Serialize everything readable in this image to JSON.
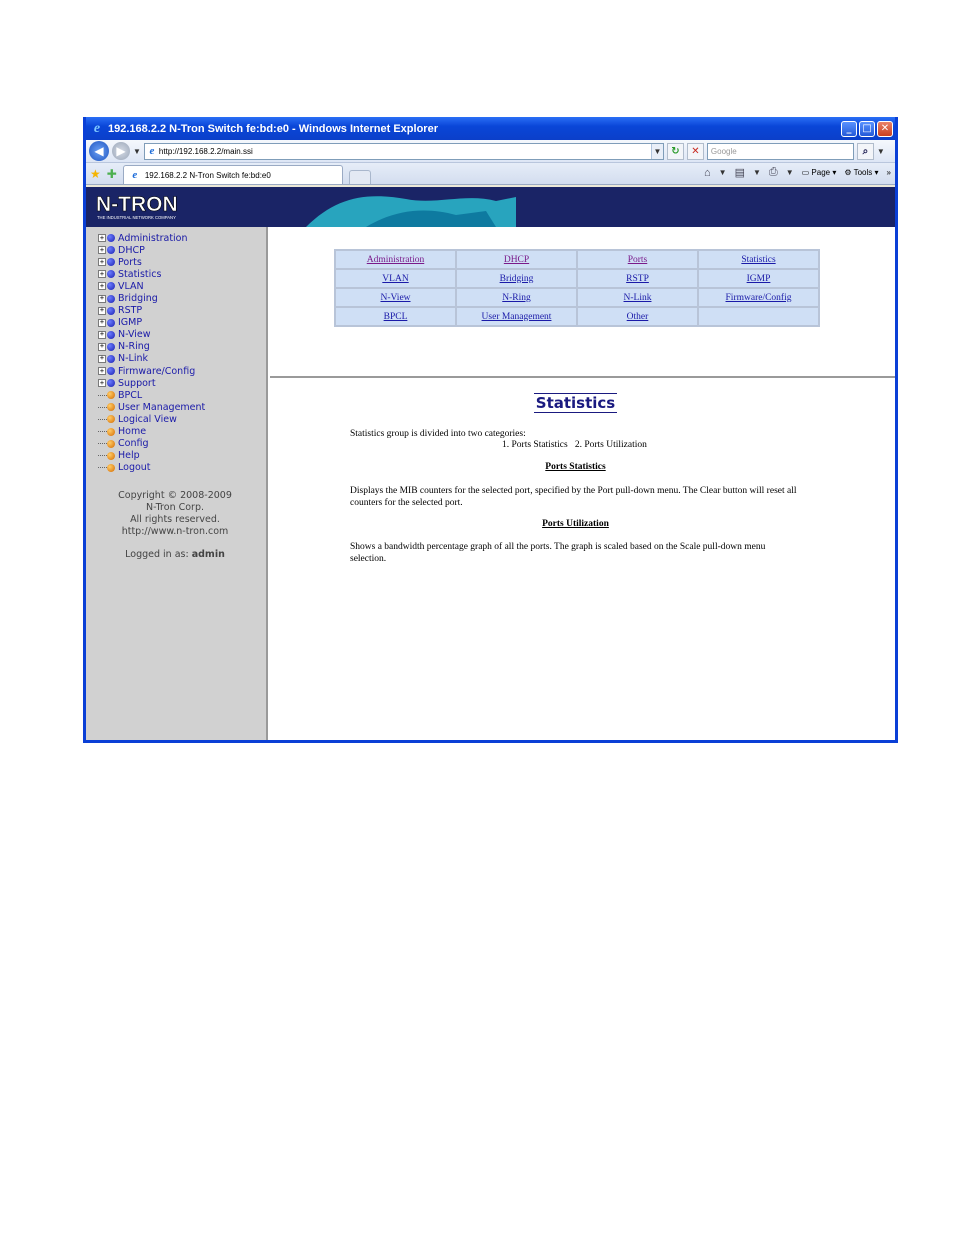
{
  "window": {
    "title": "192.168.2.2 N-Tron Switch fe:bd:e0 - Windows Internet Explorer",
    "buttons": [
      "minimize",
      "maximize",
      "close"
    ]
  },
  "address_bar": {
    "url": "http://192.168.2.2/main.ssi",
    "search_placeholder": "Google"
  },
  "tabs": [
    {
      "title": "192.168.2.2 N-Tron Switch fe:bd:e0"
    }
  ],
  "command_bar": {
    "page_label": "Page",
    "tools_label": "Tools"
  },
  "banner": {
    "logo_text": "N-TRON",
    "tagline": "THE INDUSTRIAL NETWORK COMPANY"
  },
  "sidebar": {
    "items": [
      {
        "label": "Administration",
        "expandable": true,
        "bullet": "blue"
      },
      {
        "label": "DHCP",
        "expandable": true,
        "bullet": "blue"
      },
      {
        "label": "Ports",
        "expandable": true,
        "bullet": "blue"
      },
      {
        "label": "Statistics",
        "expandable": true,
        "bullet": "blue"
      },
      {
        "label": "VLAN",
        "expandable": true,
        "bullet": "blue"
      },
      {
        "label": "Bridging",
        "expandable": true,
        "bullet": "blue"
      },
      {
        "label": "RSTP",
        "expandable": true,
        "bullet": "blue"
      },
      {
        "label": "IGMP",
        "expandable": true,
        "bullet": "blue"
      },
      {
        "label": "N-View",
        "expandable": true,
        "bullet": "blue"
      },
      {
        "label": "N-Ring",
        "expandable": true,
        "bullet": "blue"
      },
      {
        "label": "N-Link",
        "expandable": true,
        "bullet": "blue"
      },
      {
        "label": "Firmware/Config",
        "expandable": true,
        "bullet": "blue"
      },
      {
        "label": "Support",
        "expandable": true,
        "bullet": "blue"
      },
      {
        "label": "BPCL",
        "expandable": false,
        "bullet": "orange"
      },
      {
        "label": "User Management",
        "expandable": false,
        "bullet": "orange"
      },
      {
        "label": "Logical View",
        "expandable": false,
        "bullet": "orange"
      },
      {
        "label": "Home",
        "expandable": false,
        "bullet": "orange"
      },
      {
        "label": "Config",
        "expandable": false,
        "bullet": "orange"
      },
      {
        "label": "Help",
        "expandable": false,
        "bullet": "orange"
      },
      {
        "label": "Logout",
        "expandable": false,
        "bullet": "orange"
      }
    ],
    "copyright": [
      "Copyright © 2008-2009",
      "N-Tron Corp.",
      "All rights reserved.",
      "http://www.n-tron.com"
    ],
    "logged_in_label": "Logged in as:",
    "logged_in_user": "admin"
  },
  "nav_table": {
    "rows": [
      [
        "Administration",
        "DHCP",
        "Ports",
        "Statistics"
      ],
      [
        "VLAN",
        "Bridging",
        "RSTP",
        "IGMP"
      ],
      [
        "N-View",
        "N-Ring",
        "N-Link",
        "Firmware/Config"
      ],
      [
        "BPCL",
        "User Management",
        "Other",
        ""
      ]
    ]
  },
  "main": {
    "title": "Statistics",
    "intro": "Statistics group is divided into two categories:",
    "categories": "1. Ports Statistics   2. Ports Utilization",
    "section1_heading": "Ports Statistics",
    "section1_text": "Displays the MIB counters for the selected port, specified by the Port pull-down menu. The Clear button will reset all counters for the selected port.",
    "section2_heading": "Ports Utilization",
    "section2_text": "Shows a bandwidth percentage graph of all the ports. The graph is scaled based on the Scale pull-down menu selection."
  }
}
